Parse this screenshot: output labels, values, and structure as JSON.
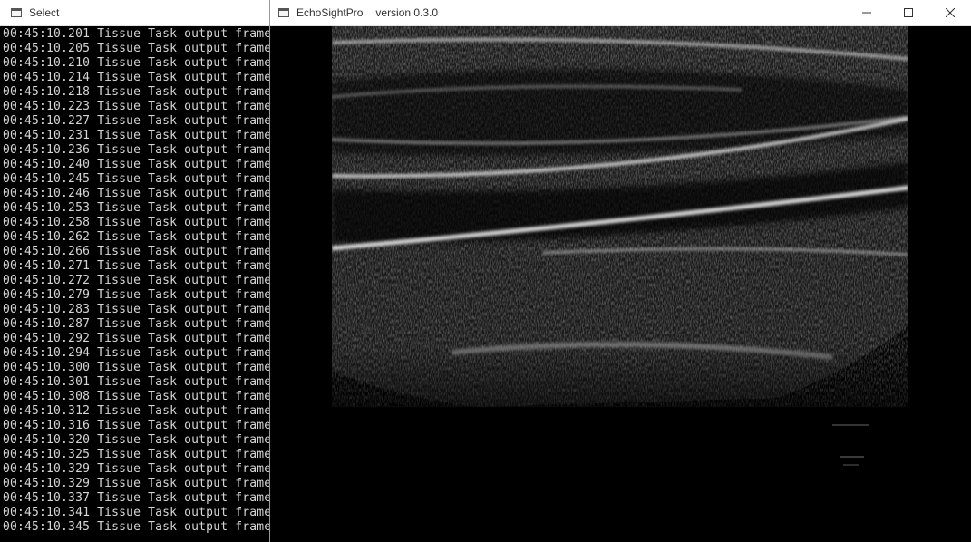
{
  "console": {
    "title": "Select",
    "lines": [
      "00:45:10.201 Tissue Task output frame",
      "00:45:10.205 Tissue Task output frame",
      "00:45:10.210 Tissue Task output frame",
      "00:45:10.214 Tissue Task output frame",
      "00:45:10.218 Tissue Task output frame",
      "00:45:10.223 Tissue Task output frame",
      "00:45:10.227 Tissue Task output frame",
      "00:45:10.231 Tissue Task output frame",
      "00:45:10.236 Tissue Task output frame",
      "00:45:10.240 Tissue Task output frame",
      "00:45:10.245 Tissue Task output frame",
      "00:45:10.246 Tissue Task output frame",
      "00:45:10.253 Tissue Task output frame",
      "00:45:10.258 Tissue Task output frame",
      "00:45:10.262 Tissue Task output frame",
      "00:45:10.266 Tissue Task output frame",
      "00:45:10.271 Tissue Task output frame",
      "00:45:10.272 Tissue Task output frame",
      "00:45:10.279 Tissue Task output frame",
      "00:45:10.283 Tissue Task output frame",
      "00:45:10.287 Tissue Task output frame",
      "00:45:10.292 Tissue Task output frame",
      "00:45:10.294 Tissue Task output frame",
      "00:45:10.300 Tissue Task output frame",
      "00:45:10.301 Tissue Task output frame",
      "00:45:10.308 Tissue Task output frame",
      "00:45:10.312 Tissue Task output frame",
      "00:45:10.316 Tissue Task output frame",
      "00:45:10.320 Tissue Task output frame",
      "00:45:10.325 Tissue Task output frame",
      "00:45:10.329 Tissue Task output frame",
      "00:45:10.329 Tissue Task output frame",
      "00:45:10.337 Tissue Task output frame",
      "00:45:10.341 Tissue Task output frame",
      "00:45:10.345 Tissue Task output frame"
    ]
  },
  "app": {
    "title": "EchoSightPro",
    "version": "version 0.3.0",
    "window_controls": {
      "minimize_icon": "minimize-icon",
      "maximize_icon": "maximize-icon",
      "close_icon": "close-icon"
    }
  },
  "colors": {
    "console_bg": "#000000",
    "console_text": "#d6d6d6",
    "titlebar": "#ffffff"
  }
}
